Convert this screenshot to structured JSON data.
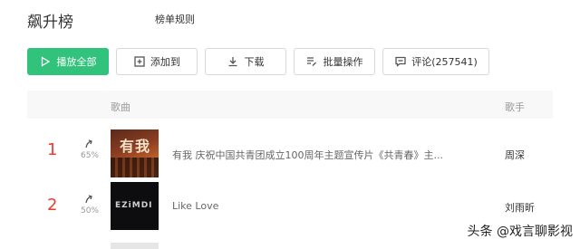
{
  "header": {
    "title": "飙升榜",
    "rules_link": "榜单规则"
  },
  "toolbar": {
    "play_all": "播放全部",
    "add_to": "添加到",
    "download": "下载",
    "batch": "批量操作",
    "comment": "评论(257541)"
  },
  "table": {
    "col_song": "歌曲",
    "col_artist": "歌手",
    "rows": [
      {
        "rank": "1",
        "change": "65%",
        "cover_text": "有我",
        "title": "有我   庆祝中国共青团成立100周年主题宣传片《共青春》主...",
        "artist": "周深"
      },
      {
        "rank": "2",
        "change": "50%",
        "cover_text": "EZiMDI",
        "title": "Like Love",
        "artist": "刘雨昕"
      }
    ]
  },
  "watermark": "头条 @戏言聊影视",
  "colors": {
    "accent": "#31c27c",
    "rank": "#e83d2e"
  }
}
